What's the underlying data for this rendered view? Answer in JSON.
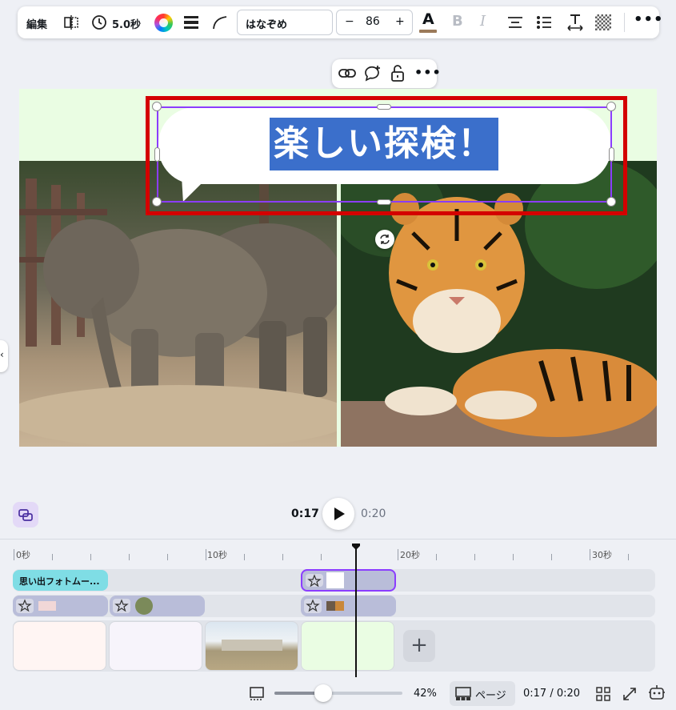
{
  "toolbar": {
    "edit_label": "編集",
    "duration_label": "5.0秒",
    "font_name": "はなぞめ",
    "font_size": "86",
    "size_minus": "−",
    "size_plus": "+",
    "text_color": "#7a4a2a"
  },
  "canvas": {
    "title_text": "楽しい探検！",
    "background_color": "#eafde3",
    "highlight_color": "#3b6fcb"
  },
  "playback": {
    "current_time": "0:17",
    "total_time": "0:20"
  },
  "ruler": {
    "labels": [
      "0秒",
      "10秒",
      "20秒",
      "30秒"
    ]
  },
  "tracks": {
    "text_clip_label": "思い出フォトムー..."
  },
  "bottom_bar": {
    "zoom": "42%",
    "page_label": "ページ",
    "time_display": "0:17 / 0:20"
  },
  "colors": {
    "accent": "#8b3dff",
    "selection_red": "#d40000"
  }
}
